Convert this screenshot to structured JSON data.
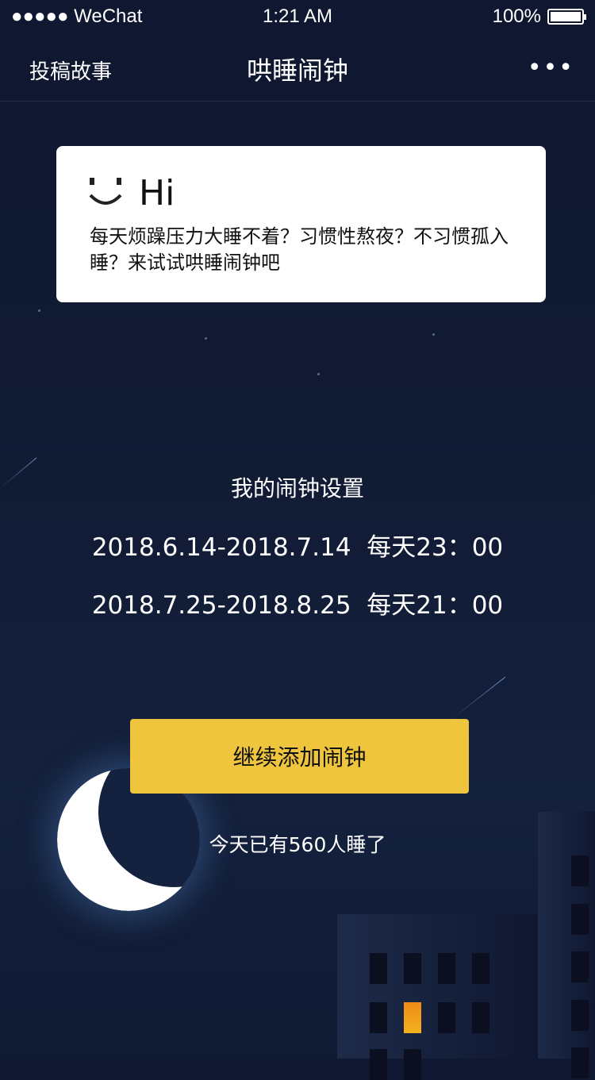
{
  "status_bar": {
    "carrier": "●●●●● WeChat",
    "time": "1:21 AM",
    "battery": "100%"
  },
  "nav": {
    "left_label": "投稿故事",
    "title": "哄睡闹钟",
    "more": "•••"
  },
  "card": {
    "greeting": "Hi",
    "text": "每天烦躁压力大睡不着？习惯性熬夜？不习惯孤入睡？来试试哄睡闹钟吧"
  },
  "alarms": {
    "heading": "我的闹钟设置",
    "items": [
      "2018.6.14-2018.7.14  每天23：00",
      "2018.7.25-2018.8.25  每天21：00"
    ]
  },
  "add_button": "继续添加闹钟",
  "sleep_count": "今天已有560人睡了"
}
